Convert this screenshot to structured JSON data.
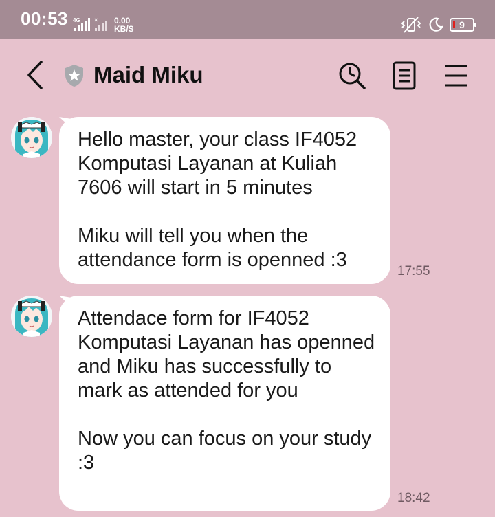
{
  "status_bar": {
    "time": "00:53",
    "network": "4G",
    "speed_value": "0.00",
    "speed_unit": "KB/S",
    "battery": "9"
  },
  "header": {
    "title": "Maid Miku",
    "icons": [
      "back-arrow-icon",
      "shield-star-icon",
      "search-icon",
      "notes-icon",
      "menu-icon"
    ]
  },
  "messages": [
    {
      "sender": "Maid Miku",
      "text": "Hello master, your class IF4052 Komputasi Layanan at Kuliah 7606 will start in 5 minutes\n\nMiku will tell you when the attendance form is openned :3",
      "time": "17:55"
    },
    {
      "sender": "Maid Miku",
      "text": "Attendace form for IF4052 Komputasi Layanan has openned and Miku has successfully to mark as attended for you\n\nNow you can focus on your study :3",
      "time": "18:42"
    }
  ],
  "colors": {
    "status_bar": "#a48b94",
    "chat_background": "#e7c2cd",
    "bubble": "#ffffff",
    "battery_low": "#e0201c"
  }
}
